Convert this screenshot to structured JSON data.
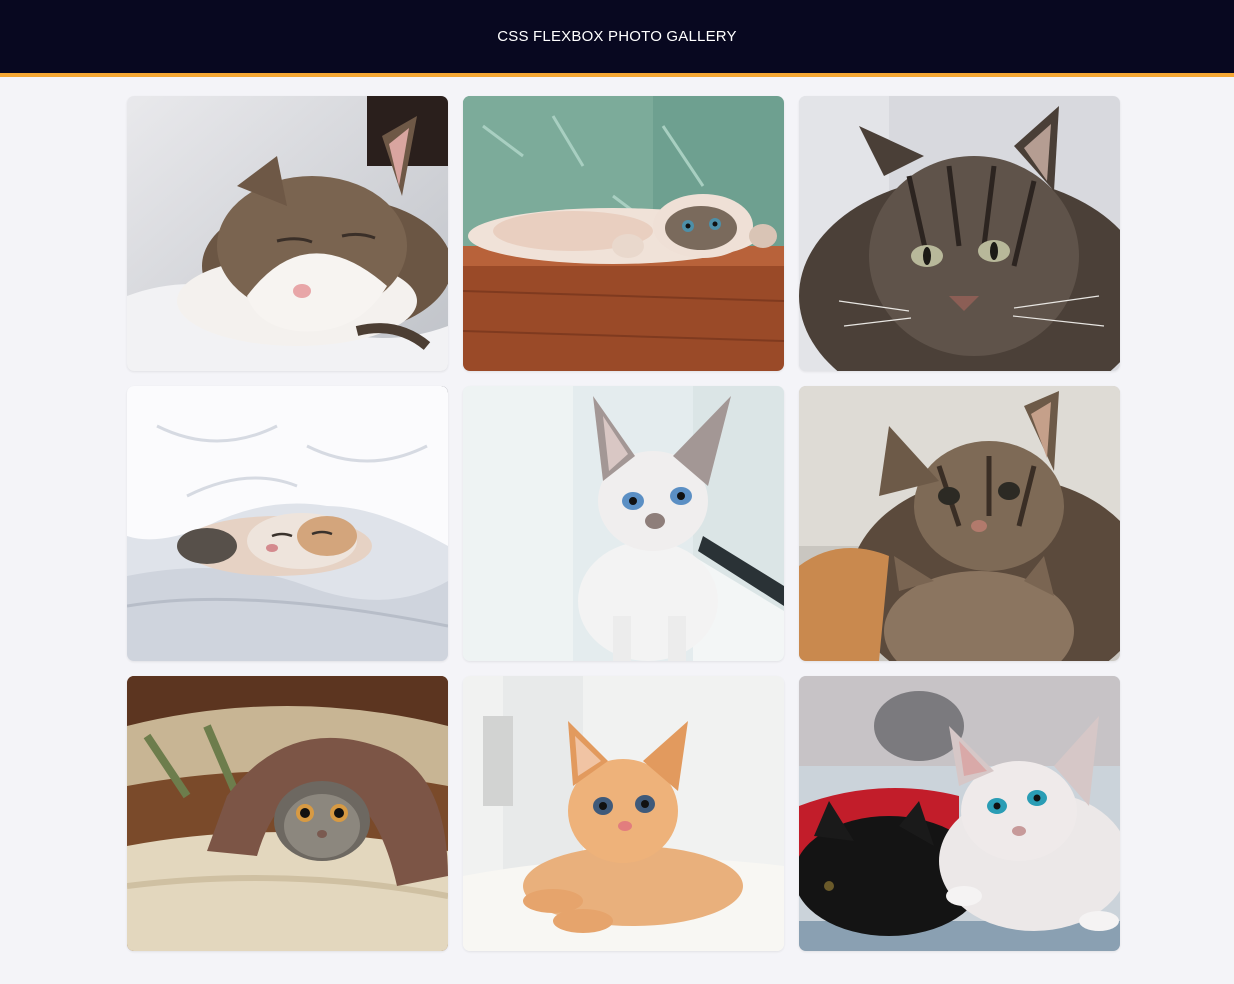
{
  "header": {
    "title": "CSS FLEXBOX PHOTO GALLERY",
    "background": "#080820",
    "accent": "#f5a733"
  },
  "gallery": {
    "photos": [
      {
        "name": "cat-photo-1",
        "subject": "tabby-and-white cat sleeping on white bedding"
      },
      {
        "name": "cat-photo-2",
        "subject": "cat lying upside down on wooden floor"
      },
      {
        "name": "cat-photo-3",
        "subject": "grey long-haired tabby cat portrait"
      },
      {
        "name": "cat-photo-4",
        "subject": "calico cat sleeping under white duvet"
      },
      {
        "name": "cat-photo-5",
        "subject": "white blue-eyed kitten by window"
      },
      {
        "name": "cat-photo-6",
        "subject": "two tabby kittens"
      },
      {
        "name": "cat-photo-7",
        "subject": "grey tabby cat under brown blanket"
      },
      {
        "name": "cat-photo-8",
        "subject": "orange kitten lying on white cushion"
      },
      {
        "name": "cat-photo-9",
        "subject": "black kitten and white kitten on red blanket"
      }
    ]
  }
}
